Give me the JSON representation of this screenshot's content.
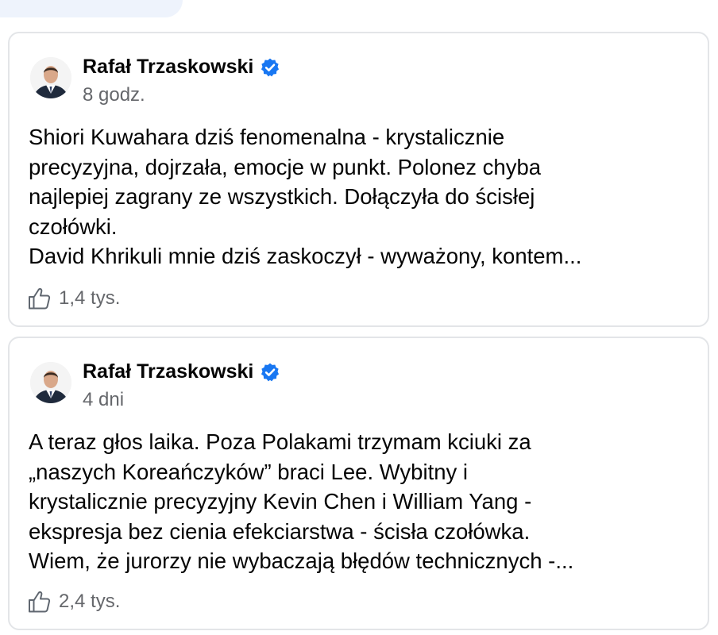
{
  "posts": [
    {
      "author": "Rafał Trzaskowski",
      "verified": true,
      "time": "8 godz.",
      "lines": [
        "Shiori Kuwahara dziś fenomenalna - krystalicznie",
        "precyzyjna, dojrzała, emocje w punkt. Polonez chyba",
        "najlepiej zagrany ze wszystkich. Dołączyła do ścisłej",
        "czołówki.",
        "David Khrikuli mnie dziś zaskoczył - wyważony, kontem..."
      ],
      "likes": "1,4 tys."
    },
    {
      "author": "Rafał Trzaskowski",
      "verified": true,
      "time": "4 dni",
      "lines": [
        "A teraz głos laika. Poza Polakami trzymam kciuki za",
        "„naszych Koreańczyków” braci Lee. Wybitny i",
        "krystalicznie precyzyjny Kevin Chen i William Yang -",
        "ekspresja bez cienia efekciarstwa - ścisła czołówka.",
        "Wiem, że jurorzy nie wybaczają błędów technicznych -..."
      ],
      "likes": "2,4 tys."
    }
  ],
  "colors": {
    "verified_badge": "#1877f2",
    "secondary_text": "#65676b",
    "card_border": "#e3e5e8"
  },
  "icons": {
    "verified": "verified-badge-icon",
    "like": "thumbs-up-icon"
  }
}
